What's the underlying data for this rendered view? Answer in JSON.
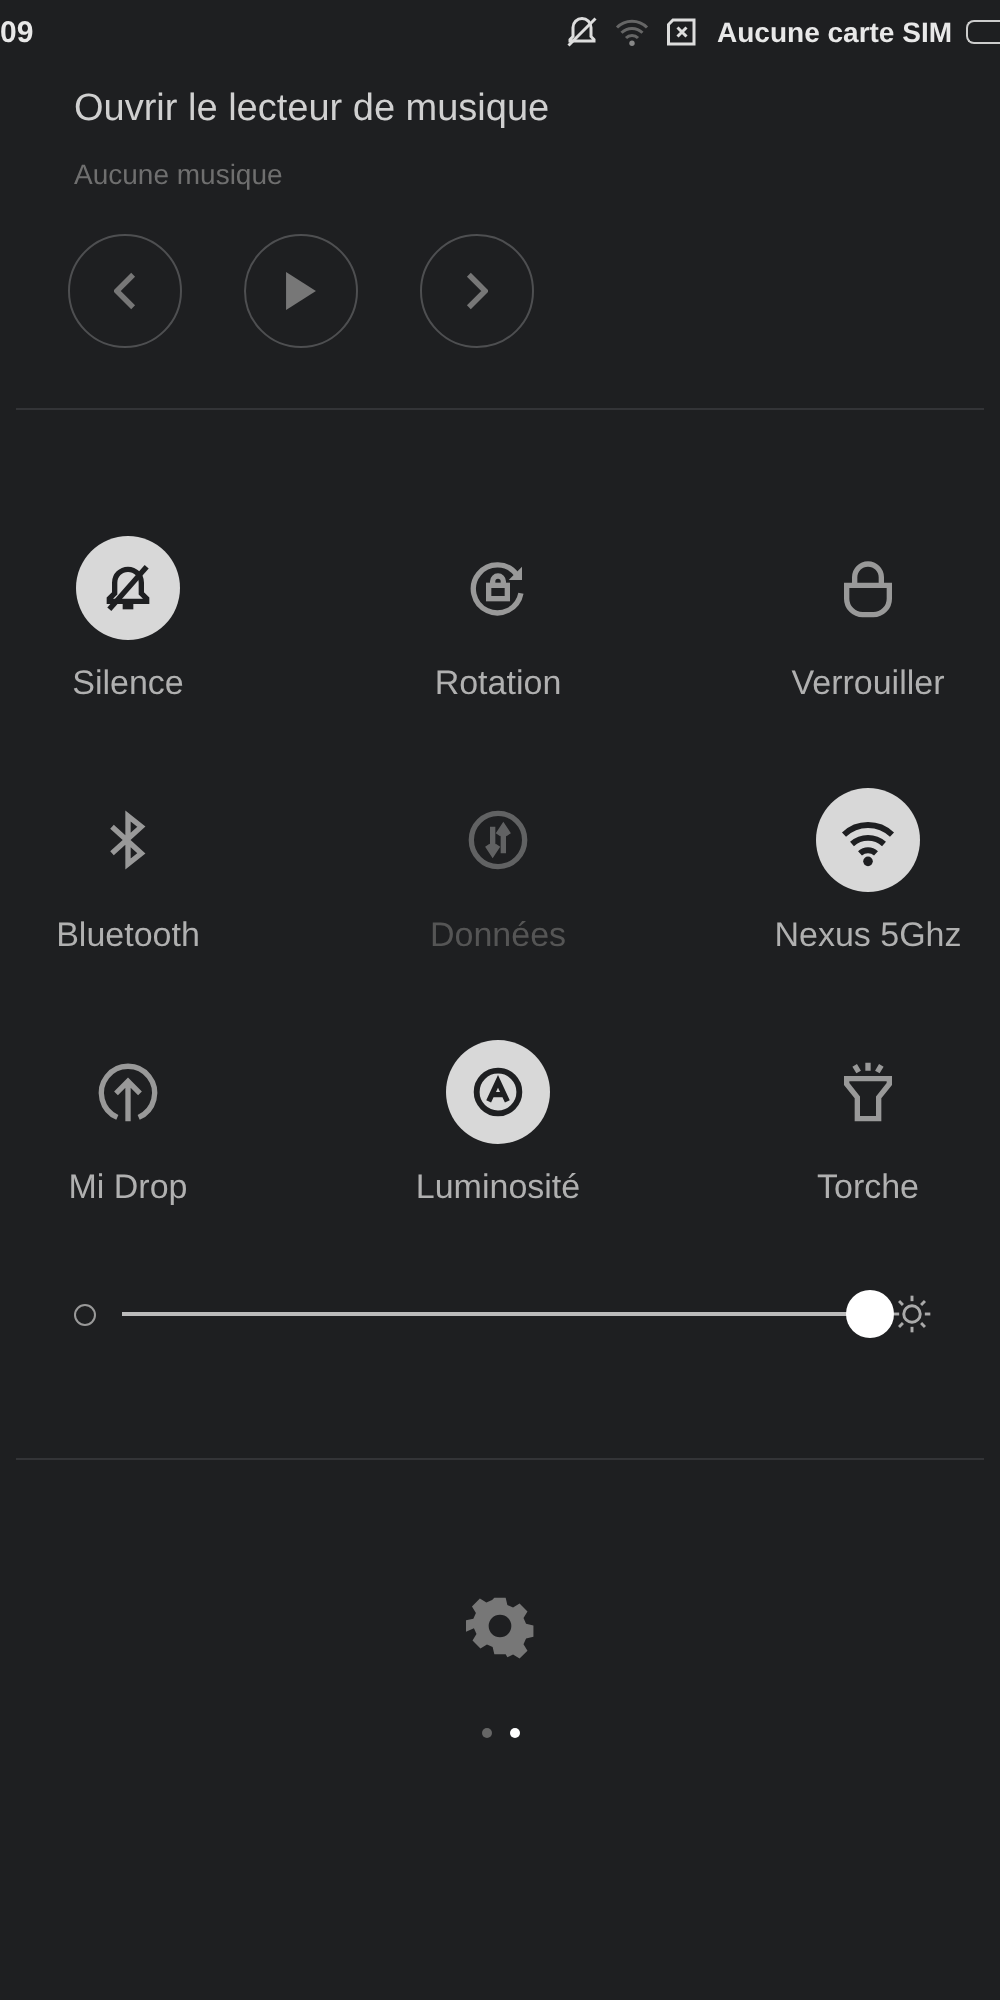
{
  "status_bar": {
    "time": "09",
    "carrier": "Aucune carte SIM"
  },
  "music": {
    "title": "Ouvrir le lecteur de musique",
    "subtitle": "Aucune musique",
    "controls": [
      {
        "kind": "previous"
      },
      {
        "kind": "play"
      },
      {
        "kind": "next"
      }
    ]
  },
  "tiles": [
    {
      "kind": "silence",
      "label": "Silence",
      "on": true,
      "disabled": false
    },
    {
      "kind": "rotation",
      "label": "Rotation",
      "on": false,
      "disabled": false
    },
    {
      "kind": "lock",
      "label": "Verrouiller",
      "on": false,
      "disabled": false
    },
    {
      "kind": "bluetooth",
      "label": "Bluetooth",
      "on": false,
      "disabled": false
    },
    {
      "kind": "data",
      "label": "Données",
      "on": false,
      "disabled": true
    },
    {
      "kind": "wifi",
      "label": "Nexus 5Ghz",
      "on": true,
      "disabled": false
    },
    {
      "kind": "midrop",
      "label": "Mi Drop",
      "on": false,
      "disabled": false
    },
    {
      "kind": "brightness",
      "label": "Luminosité",
      "on": true,
      "disabled": false
    },
    {
      "kind": "torch",
      "label": "Torche",
      "on": false,
      "disabled": false
    }
  ],
  "brightness": {
    "level": 0.976
  },
  "pages": [
    {
      "selected": false
    },
    {
      "selected": true
    }
  ]
}
